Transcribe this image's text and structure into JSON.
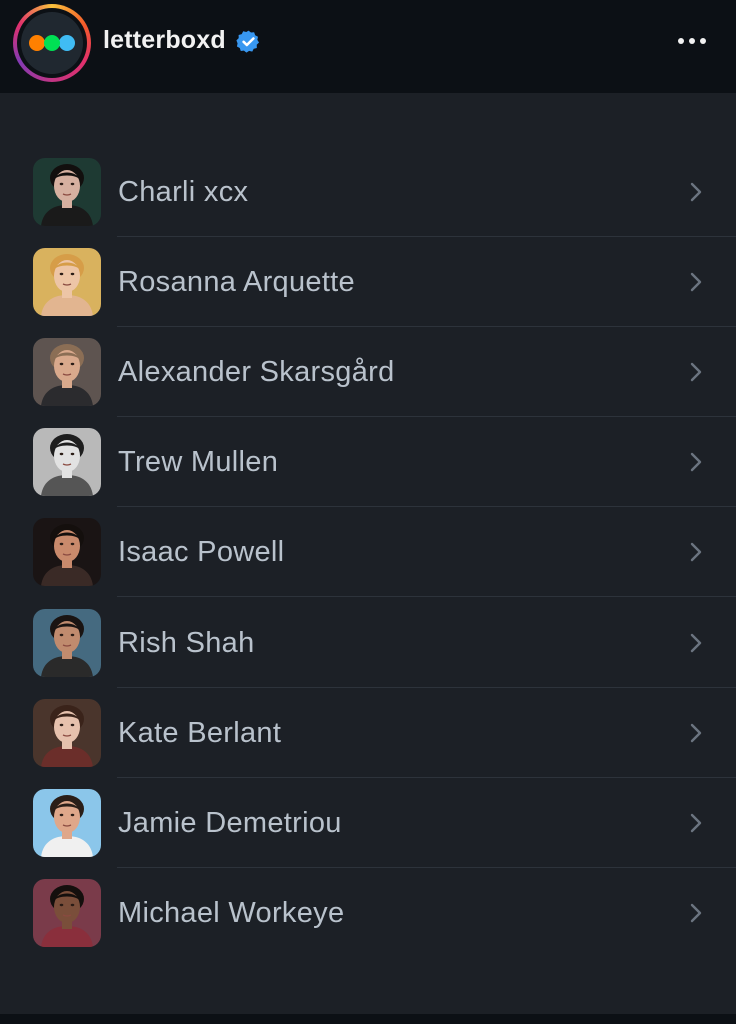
{
  "header": {
    "username": "letterboxd",
    "profile_icon": "letterboxd-dots-logo",
    "verified_icon": "verified-badge-icon",
    "more_icon": "more-options-icon",
    "logo_colors": [
      "#ff8000",
      "#00e054",
      "#40bcf4"
    ]
  },
  "list": {
    "items": [
      {
        "name": "Charli xcx",
        "photo": "headshot-charli-xcx",
        "photo_colors": {
          "bg": "#1e3a33",
          "skin": "#d6b0a0",
          "hair": "#120f0e",
          "shirt": "#1a1a1a"
        }
      },
      {
        "name": "Rosanna Arquette",
        "photo": "headshot-rosanna-arquette",
        "photo_colors": {
          "bg": "#d9b25e",
          "skin": "#edc5a6",
          "hair": "#d69d48",
          "shirt": "#e2b590"
        }
      },
      {
        "name": "Alexander Skarsgård",
        "photo": "headshot-alexander-skarsgard",
        "photo_colors": {
          "bg": "#5e5450",
          "skin": "#d9a98c",
          "hair": "#8b6e55",
          "shirt": "#2b2b2e"
        }
      },
      {
        "name": "Trew Mullen",
        "photo": "headshot-trew-mullen",
        "photo_colors": {
          "bg": "#b9b9b9",
          "skin": "#e2e2e2",
          "hair": "#1e1e1e",
          "shirt": "#555555"
        }
      },
      {
        "name": "Isaac Powell",
        "photo": "headshot-isaac-powell",
        "photo_colors": {
          "bg": "#1a1414",
          "skin": "#c98a6c",
          "hair": "#140f0d",
          "shirt": "#3a2a26"
        }
      },
      {
        "name": "Rish Shah",
        "photo": "headshot-rish-shah",
        "photo_colors": {
          "bg": "#456a80",
          "skin": "#c08b6e",
          "hair": "#1a1412",
          "shirt": "#2a2a2a"
        }
      },
      {
        "name": "Kate Berlant",
        "photo": "headshot-kate-berlant",
        "photo_colors": {
          "bg": "#4a352c",
          "skin": "#e6c1ad",
          "hair": "#3a231a",
          "shirt": "#6b2e2a"
        }
      },
      {
        "name": "Jamie Demetriou",
        "photo": "headshot-jamie-demetriou",
        "photo_colors": {
          "bg": "#8bc6ea",
          "skin": "#dfa78a",
          "hair": "#2a1e18",
          "shirt": "#f0f0f0"
        }
      },
      {
        "name": "Michael Workeye",
        "photo": "headshot-michael-workeye",
        "photo_colors": {
          "bg": "#7a3b4a",
          "skin": "#7a4e3a",
          "hair": "#140f0d",
          "shirt": "#8a2f3c"
        }
      }
    ],
    "chevron_icon": "chevron-right-icon"
  }
}
